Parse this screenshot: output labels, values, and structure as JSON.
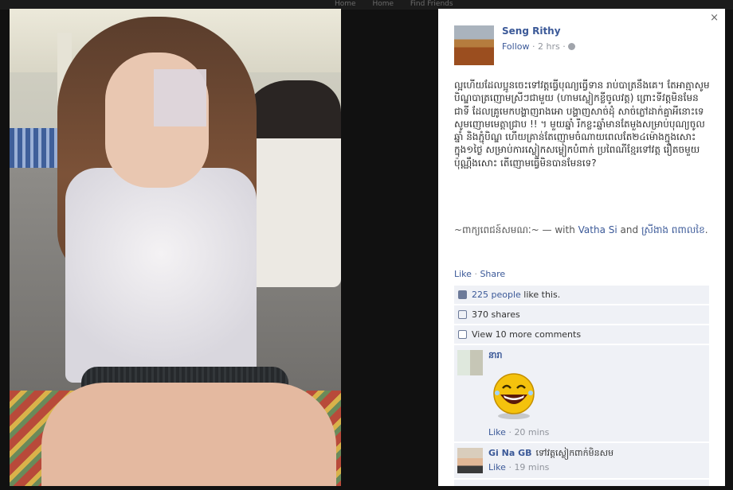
{
  "topbar": {
    "links": [
      "Home",
      "Home",
      "Find Friends"
    ]
  },
  "photo": {},
  "panel": {
    "close_glyph": "×",
    "author": "Seng Rithy",
    "follow": "Follow",
    "dot": "·",
    "time": "2 hrs",
    "post_text": "ល្អហើយដែលប្អូនចេះទៅវត្តធ្វើបុណ្យធ្វើទាន រាប់បាត្រនឹងគេ។ តែអាត្មាសូមបិណ្ឌបាត្រញោមស្រីៗជាមួយ (ហាមស្លៀកខ្លីចូលវត្ត) ព្រោះទីវត្តមិនមែនជាទី ដែលគ្រូមេកបង្ហាញរាងអោ បង្ហាញសាច់ដុំ សាច់ភ្លៅដាក់គ្នាអីនោះទេ សូមញោមមេត្តាជ្រាប !! ។ មួយឆ្នាំ រីកខ្លះឆ្នាំមានតែមួងសម្រាប់បុណ្យចូលឆ្នាំ និងភ្ជុំបិណ្ឌ ហើយគ្រាន់តែញោមចំណាយពេលតែ២៤ម៉ោងក្នុងសោះក្នុង១ថ្ងៃ សម្រាប់ការស្លៀកសម្លៀកបំពាក់ ប្រពៃណីខ្មែរទៅវត្ត រឿតចមួយប៉ុណ្ណឹងសោះ តើញោមធ្វើមិនបានមែនទេ?",
    "tag_prefix": "~ពាក្យពេជន៍សមណៈ~ — with ",
    "tag_name1": "Vatha Si",
    "tag_and": " and ",
    "tag_name2": "ស្រីងាង ពពាលខៃ",
    "tag_end": ".",
    "like_action": "Like",
    "share_action": "Share",
    "likes_count": "225 people",
    "likes_suffix": " like this.",
    "shares": "370 shares",
    "view_more": "View 10 more comments",
    "comments": [
      {
        "name": "នារា",
        "text": "",
        "like": "Like",
        "time": "20 mins"
      },
      {
        "name": "Gi Na GB",
        "text": "ទៅវត្តស្លៀកពាក់មិនសម",
        "like": "Like",
        "time": "19 mins"
      }
    ]
  }
}
